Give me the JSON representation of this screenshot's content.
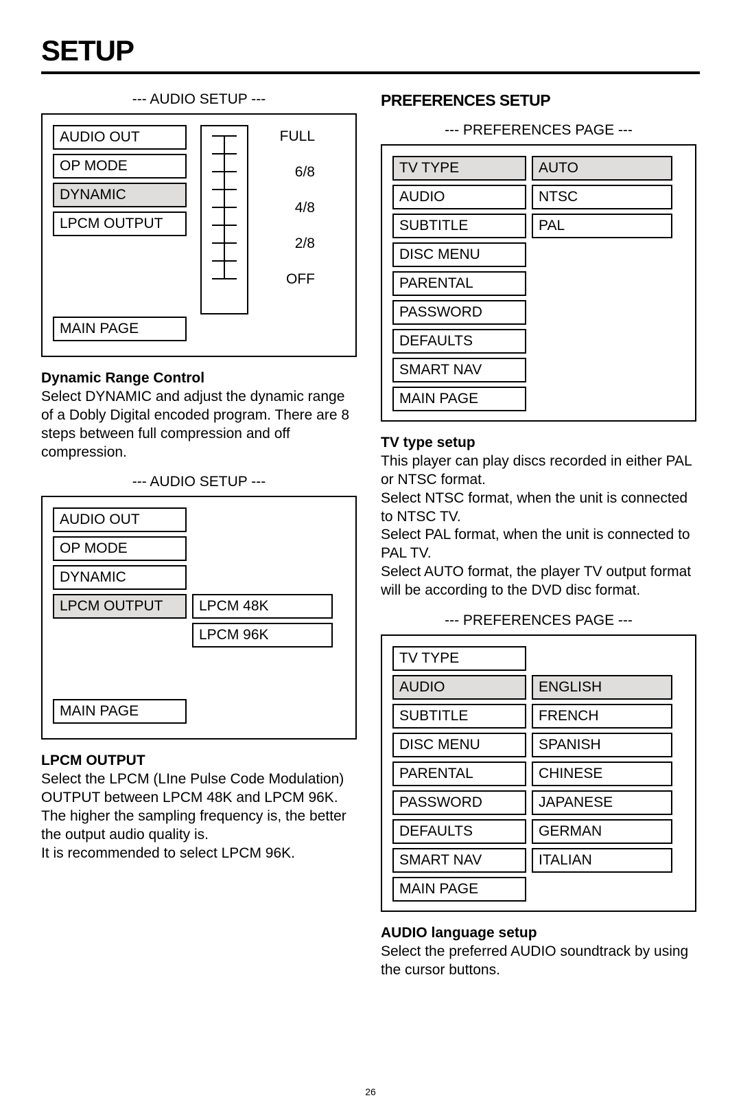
{
  "page_title": "SETUP",
  "page_number": "26",
  "left": {
    "audio1": {
      "title": "--- AUDIO SETUP ---",
      "items": [
        "AUDIO OUT",
        "OP MODE",
        "DYNAMIC",
        "LPCM OUTPUT"
      ],
      "selected_index": 2,
      "main_page": "MAIN PAGE",
      "slider_labels": [
        "FULL",
        "6/8",
        "4/8",
        "2/8",
        "OFF"
      ]
    },
    "text1_head": "Dynamic Range Control",
    "text1_body": "Select DYNAMIC and adjust the dynamic range of a Dobly Digital encoded program.  There are 8 steps between full compression and off compression.",
    "audio2": {
      "title": "--- AUDIO SETUP ---",
      "items": [
        "AUDIO OUT",
        "OP MODE",
        "DYNAMIC",
        "LPCM OUTPUT"
      ],
      "selected_index": 3,
      "main_page": "MAIN PAGE",
      "right_items": [
        "LPCM 48K",
        "LPCM 96K"
      ]
    },
    "text2_head": "LPCM OUTPUT",
    "text2_body": "Select the LPCM (LIne Pulse Code Modulation) OUTPUT between LPCM 48K and LPCM 96K. The higher the sampling frequency is, the better the output audio quality is.\nIt is recommended to select LPCM 96K."
  },
  "right": {
    "heading": "PREFERENCES SETUP",
    "pref1": {
      "title": "--- PREFERENCES PAGE ---",
      "items": [
        "TV TYPE",
        "AUDIO",
        "SUBTITLE",
        "DISC MENU",
        "PARENTAL",
        "PASSWORD",
        "DEFAULTS",
        "SMART NAV",
        "MAIN PAGE"
      ],
      "selected_index": 0,
      "right_items": [
        "AUTO",
        "NTSC",
        "PAL"
      ],
      "right_selected_index": 0
    },
    "text1_head": "TV type setup",
    "text1_body": "This player can play discs recorded in either PAL or NTSC format.\nSelect NTSC format, when the unit is connected to NTSC TV.\nSelect PAL format, when  the unit is connected to PAL TV.\nSelect AUTO format, the player TV output format will be according to the DVD disc format.",
    "pref2": {
      "title": "--- PREFERENCES PAGE ---",
      "items": [
        "TV TYPE",
        "AUDIO",
        "SUBTITLE",
        "DISC MENU",
        "PARENTAL",
        "PASSWORD",
        "DEFAULTS",
        "SMART NAV",
        "MAIN PAGE"
      ],
      "selected_index": 1,
      "right_items": [
        "ENGLISH",
        "FRENCH",
        "SPANISH",
        "CHINESE",
        "JAPANESE",
        "GERMAN",
        "ITALIAN"
      ],
      "right_selected_index": 0
    },
    "text2_head": "AUDIO language setup",
    "text2_body": "Select the preferred AUDIO soundtrack by using the cursor buttons."
  }
}
